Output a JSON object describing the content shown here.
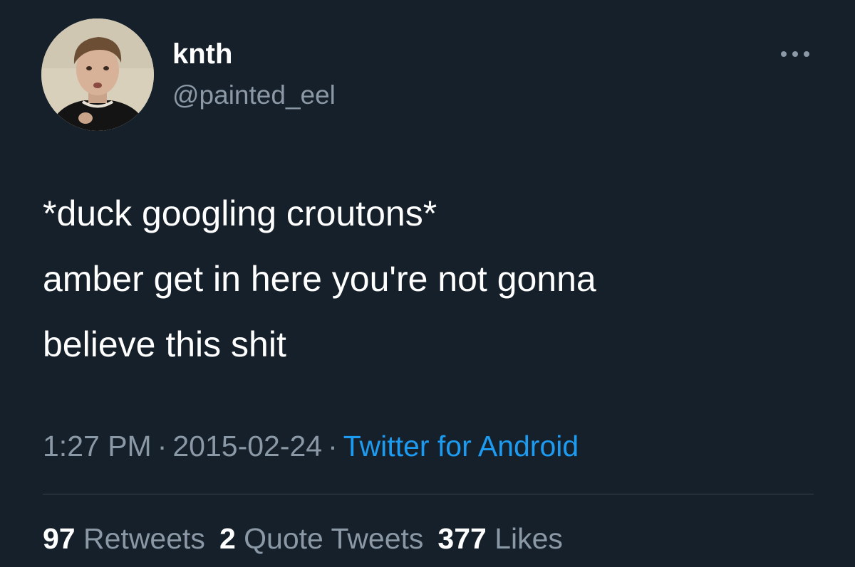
{
  "user": {
    "display_name": "knth",
    "handle": "@painted_eel",
    "avatar_icon": "profile-photo"
  },
  "header": {
    "more_icon": "more-horizontal-icon"
  },
  "tweet": {
    "lines": [
      "*duck googling croutons*",
      "amber get in here you're not gonna",
      "believe this shit"
    ]
  },
  "meta": {
    "time": "1:27 PM",
    "separator": "·",
    "date": "2015-02-24",
    "source": "Twitter for Android"
  },
  "stats": {
    "retweets_count": "97",
    "retweets_label": "Retweets",
    "quotes_count": "2",
    "quotes_label": "Quote Tweets",
    "likes_count": "377",
    "likes_label": "Likes"
  },
  "colors": {
    "background": "#15202b",
    "primary_text": "#ffffff",
    "secondary_text": "#8b98a5",
    "link": "#1d9bf0",
    "divider": "#38444d"
  }
}
